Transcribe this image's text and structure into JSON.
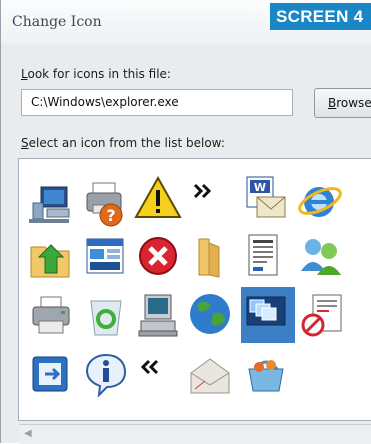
{
  "window": {
    "title": "Change Icon"
  },
  "badge": "SCREEN 4",
  "file_label": {
    "mnemonic": "L",
    "rest": "ook for icons in this file:"
  },
  "file_path": "C:\\Windows\\explorer.exe",
  "browse": {
    "mnemonic": "B",
    "rest": "rowse"
  },
  "list_label": {
    "mnemonic": "S",
    "rest": "elect an icon from the list below:"
  },
  "icons": [
    "computer-network-icon",
    "printer-help-icon",
    "warning-icon",
    "double-right-arrow-icon",
    "word-document-icon",
    "internet-explorer-icon",
    "folder-up-arrow-icon",
    "window-panel-icon",
    "error-icon",
    "folder-icon",
    "document-text-icon",
    "users-icon",
    "printer-icon",
    "recycle-bin-icon",
    "computer-terminal-icon",
    "globe-icon",
    "desktop-windows-icon",
    "document-blocked-icon",
    "switch-window-icon",
    "info-icon",
    "double-left-arrow-icon",
    "envelope-icon",
    "shopping-basket-icon"
  ],
  "selected_icon": "desktop-windows-icon",
  "scroll_left": "◀"
}
